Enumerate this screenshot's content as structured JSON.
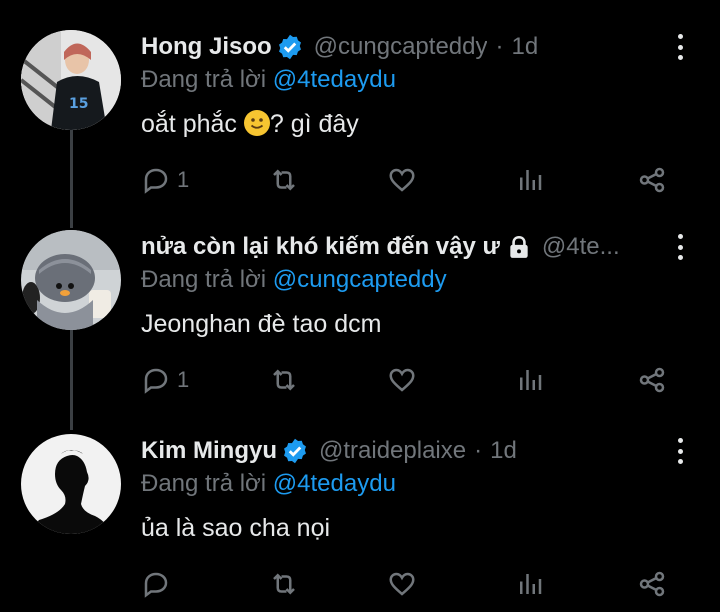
{
  "colors": {
    "background": "#000000",
    "text": "#e7e9ea",
    "muted": "#71767b",
    "link": "#1d9bf0",
    "thread_line": "#3b3f43"
  },
  "replying_label": "Đang trả lời",
  "tweets": [
    {
      "name": "Hong Jisoo",
      "verified": true,
      "handle": "@cungcapteddy",
      "time_sep": "·",
      "time": "1d",
      "replying_to": "@4tedaydu",
      "text_before_emoji": "oắt phắc ",
      "emoji": "slightly-smiling-face",
      "text_after_emoji": "? gì đây",
      "reply_count": "1"
    },
    {
      "name": "nửa còn lại khó kiếm đến vậy ư",
      "verified": false,
      "protected": true,
      "handle": "@4te...",
      "replying_to": "@cungcapteddy",
      "text": "Jeonghan đè tao dcm",
      "reply_count": "1"
    },
    {
      "name": "Kim Mingyu",
      "verified": true,
      "handle": "@traideplaixe",
      "time_sep": "·",
      "time": "1d",
      "replying_to": "@4tedaydu",
      "text": "ủa là sao cha nọi",
      "reply_count": ""
    }
  ]
}
